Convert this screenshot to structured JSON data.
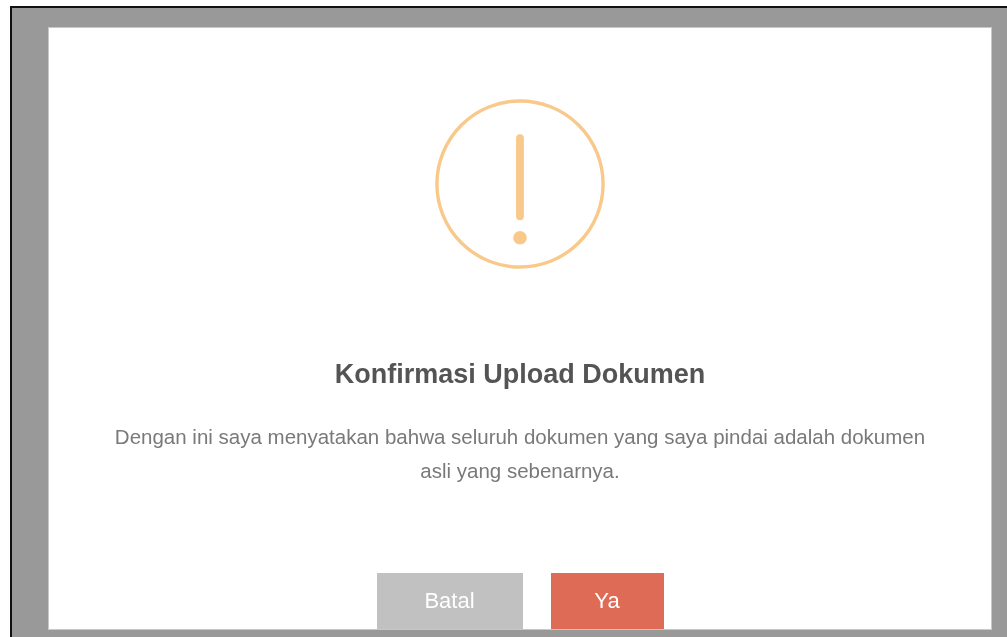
{
  "dialog": {
    "title": "Konfirmasi Upload Dokumen",
    "message": "Dengan ini saya menyatakan bahwa seluruh dokumen yang saya pindai adalah dokumen asli yang sebenarnya.",
    "buttons": [
      {
        "label": "Batal",
        "kind": "secondary"
      },
      {
        "label": "Ya",
        "kind": "primary"
      }
    ]
  }
}
